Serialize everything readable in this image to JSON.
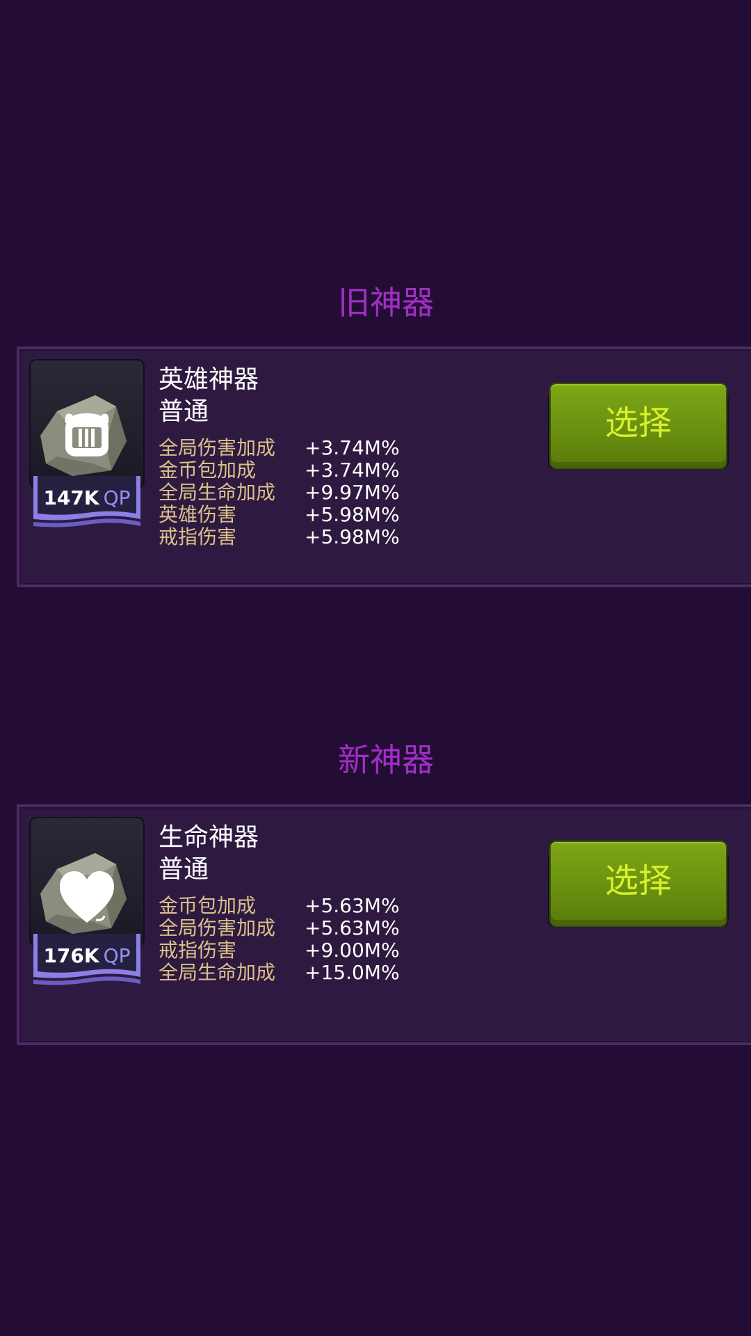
{
  "old_section": {
    "title": "旧神器",
    "item": {
      "name": "英雄神器",
      "rarity": "普通",
      "qp_value": "147K",
      "qp_unit": "QP",
      "icon": "knight-helmet-icon",
      "stats": [
        {
          "label": "全局伤害加成",
          "value": "+3.74M%"
        },
        {
          "label": "金币包加成",
          "value": "+3.74M%"
        },
        {
          "label": "全局生命加成",
          "value": "+9.97M%"
        },
        {
          "label": "英雄伤害",
          "value": "+5.98M%"
        },
        {
          "label": "戒指伤害",
          "value": "+5.98M%"
        }
      ],
      "select_label": "选择"
    }
  },
  "new_section": {
    "title": "新神器",
    "item": {
      "name": "生命神器",
      "rarity": "普通",
      "qp_value": "176K",
      "qp_unit": "QP",
      "icon": "heart-icon",
      "stats": [
        {
          "label": "金币包加成",
          "value": "+5.63M%"
        },
        {
          "label": "全局伤害加成",
          "value": "+5.63M%"
        },
        {
          "label": "戒指伤害",
          "value": "+9.00M%"
        },
        {
          "label": "全局生命加成",
          "value": "+15.0M%"
        }
      ],
      "select_label": "选择"
    }
  },
  "colors": {
    "background": "#240d34",
    "section_title": "#a02fc4",
    "panel": "#2e1a40",
    "panel_border": "#4d2a66",
    "stat_label": "#dcc08a",
    "button_green": "#6a9010",
    "button_text": "#d8f028",
    "qp_unit": "#9b8ef0"
  }
}
